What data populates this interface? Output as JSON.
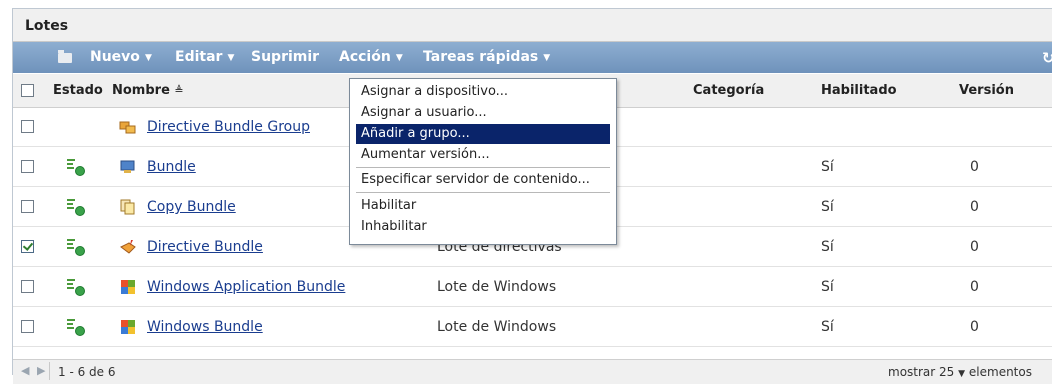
{
  "panel": {
    "title": "Lotes"
  },
  "toolbar": {
    "items": [
      "Nuevo",
      "Editar",
      "Suprimir",
      "Acción",
      "Tareas rápidas"
    ]
  },
  "table": {
    "columns": {
      "estado": "Estado",
      "nombre": "Nombre",
      "sort_indicator": "≜",
      "categoria": "Categoría",
      "habilitado": "Habilitado",
      "version": "Versión"
    },
    "rows": [
      {
        "checked": false,
        "nombre": "Directive Bundle Group",
        "categoria": "",
        "habilitado": "",
        "version": "",
        "icon": "bundle-group-icon"
      },
      {
        "checked": false,
        "nombre": "Bundle",
        "categoria": "",
        "habilitado": "Sí",
        "version": "0",
        "icon": "bundle-icon"
      },
      {
        "checked": false,
        "nombre": "Copy Bundle",
        "categoria": "",
        "habilitado": "Sí",
        "version": "0",
        "icon": "copy-bundle-icon"
      },
      {
        "checked": true,
        "nombre": "Directive Bundle",
        "categoria": "Lote de directivas",
        "habilitado": "Sí",
        "version": "0",
        "icon": "directive-bundle-icon"
      },
      {
        "checked": false,
        "nombre": "Windows Application Bundle",
        "categoria": "Lote de Windows",
        "habilitado": "Sí",
        "version": "0",
        "icon": "windows-bundle-icon"
      },
      {
        "checked": false,
        "nombre": "Windows Bundle",
        "categoria": "Lote de Windows",
        "habilitado": "Sí",
        "version": "0",
        "icon": "windows-bundle-icon"
      }
    ]
  },
  "menu": {
    "items": [
      "Asignar a dispositivo...",
      "Asignar a usuario...",
      "Añadir a grupo...",
      "Aumentar versión...",
      "Especificar servidor de contenido...",
      "Habilitar",
      "Inhabilitar"
    ],
    "selected": "Añadir a grupo..."
  },
  "footer": {
    "range": "1 - 6 de 6",
    "show_prefix": "mostrar",
    "page_size": "25",
    "show_suffix": "elementos"
  },
  "colors": {
    "toolbar": "#7b9cc4",
    "link": "#1a3d8f",
    "menu_selected": "#0a246a",
    "status_green": "#3aa24a"
  }
}
